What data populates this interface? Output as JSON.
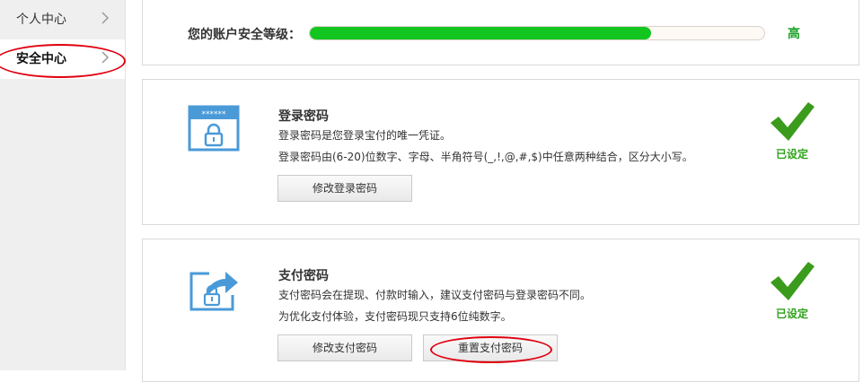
{
  "sidebar": {
    "items": [
      {
        "label": "个人中心",
        "active": false
      },
      {
        "label": "安全中心",
        "active": true
      }
    ]
  },
  "security_level": {
    "label": "您的账户安全等级：",
    "value": "高",
    "progress_fraction": 0.75,
    "fill_color": "#13c51f"
  },
  "login_password": {
    "title": "登录密码",
    "desc1": "登录密码是您登录宝付的唯一凭证。",
    "desc2": "登录密码由(6-20)位数字、字母、半角符号(_,!,@,#,$)中任意两种结合，区分大小写。",
    "button_label": "修改登录密码",
    "status": "已设定",
    "icon": "password-lock-icon",
    "icon_text": "******"
  },
  "pay_password": {
    "title": "支付密码",
    "desc1": "支付密码会在提现、付款时输入，建议支付密码与登录密码不同。",
    "desc2": "为优化支付体验，支付密码现只支持6位纯数字。",
    "modify_button_label": "修改支付密码",
    "reset_button_label": "重置支付密码",
    "status": "已设定",
    "icon": "share-lock-icon"
  },
  "colors": {
    "accent_green": "#1fa22a",
    "annotation_red": "#e0000f",
    "icon_blue": "#4a9ad8"
  }
}
